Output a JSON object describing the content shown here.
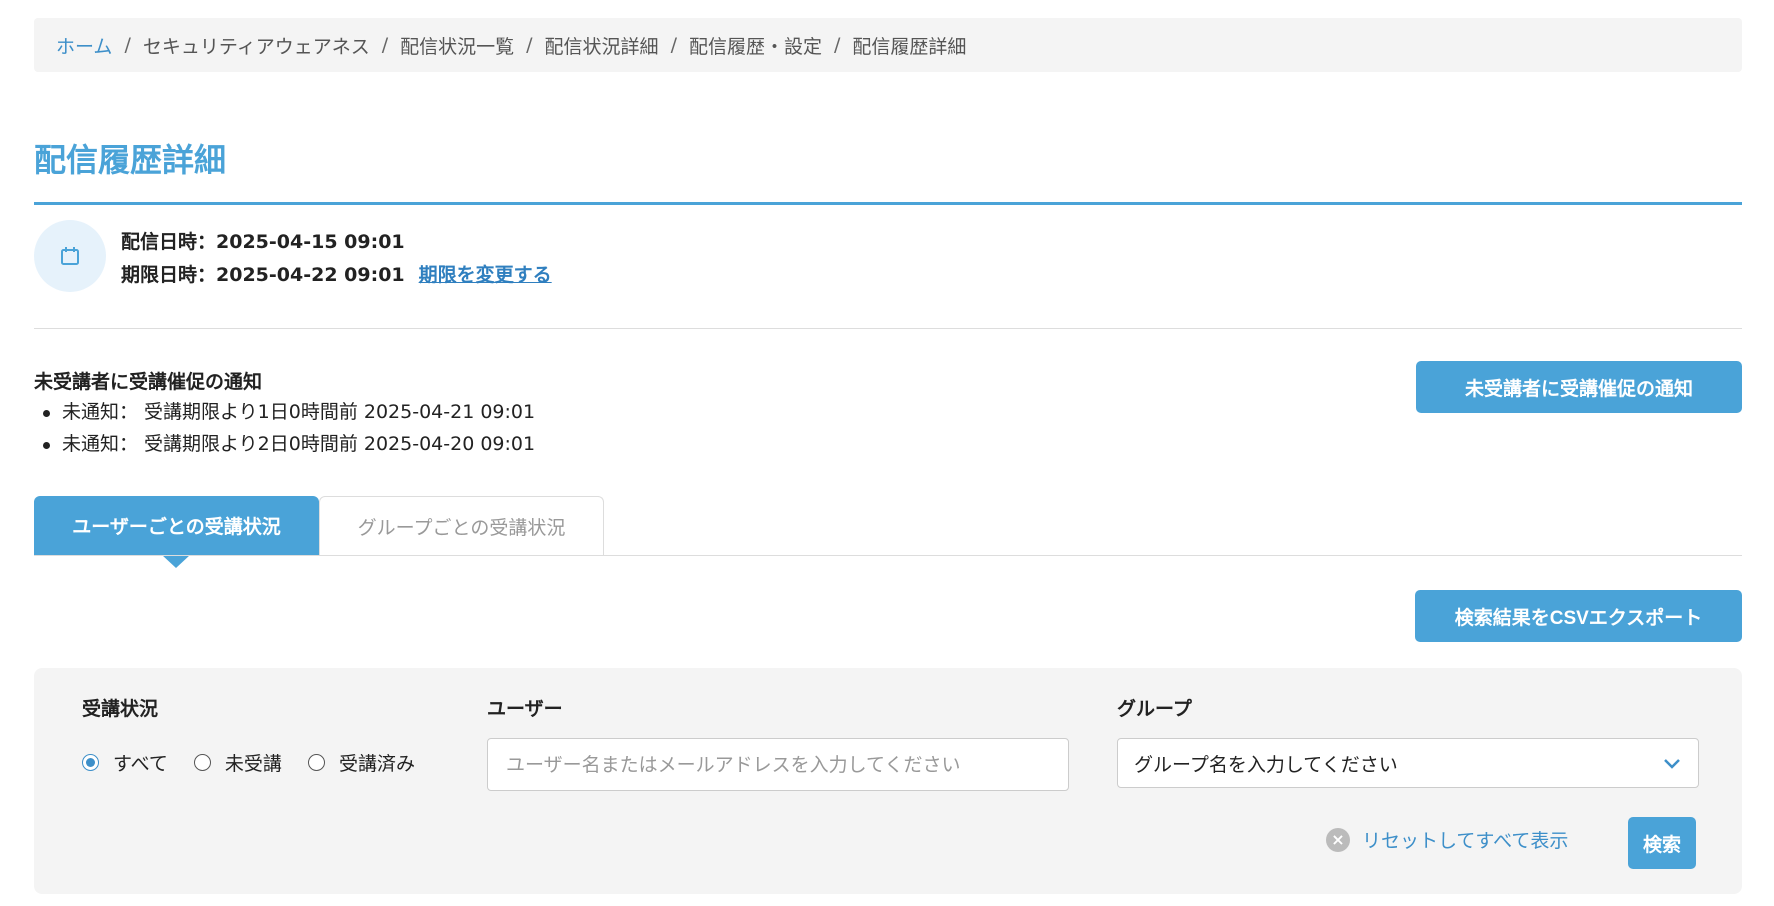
{
  "breadcrumb": {
    "items": [
      "ホーム",
      "セキュリティアウェアネス",
      "配信状況一覧",
      "配信状況詳細",
      "配信履歴・設定",
      "配信履歴詳細"
    ],
    "separator": "/"
  },
  "page": {
    "title": "配信履歴詳細"
  },
  "delivery": {
    "sent_label": "配信日時：",
    "sent_value": "2025-04-15 09:01",
    "due_label": "期限日時：",
    "due_value": "2025-04-22 09:01",
    "change_link": "期限を変更する"
  },
  "reminder": {
    "title": "未受講者に受講催促の通知",
    "items": [
      "未通知： 受講期限より1日0時間前 2025-04-21 09:01",
      "未通知： 受講期限より2日0時間前 2025-04-20 09:01"
    ],
    "button": "未受講者に受講催促の通知"
  },
  "tabs": [
    {
      "label": "ユーザーごとの受講状況",
      "active": true
    },
    {
      "label": "グループごとの受講状況",
      "active": false
    }
  ],
  "export_button": "検索結果をCSVエクスポート",
  "search": {
    "status_label": "受講状況",
    "status_options": [
      "すべて",
      "未受講",
      "受講済み"
    ],
    "status_selected": "すべて",
    "user_label": "ユーザー",
    "user_placeholder": "ユーザー名またはメールアドレスを入力してください",
    "group_label": "グループ",
    "group_placeholder": "グループ名を入力してください",
    "reset_label": "リセットしてすべて表示",
    "search_button": "検索"
  },
  "colors": {
    "accent": "#4aa3d8",
    "link": "#3d8fc9",
    "panel": "#f4f4f4"
  },
  "icons": {
    "calendar": "calendar-icon",
    "chevron": "chevron-down-icon",
    "clear": "clear-icon"
  }
}
